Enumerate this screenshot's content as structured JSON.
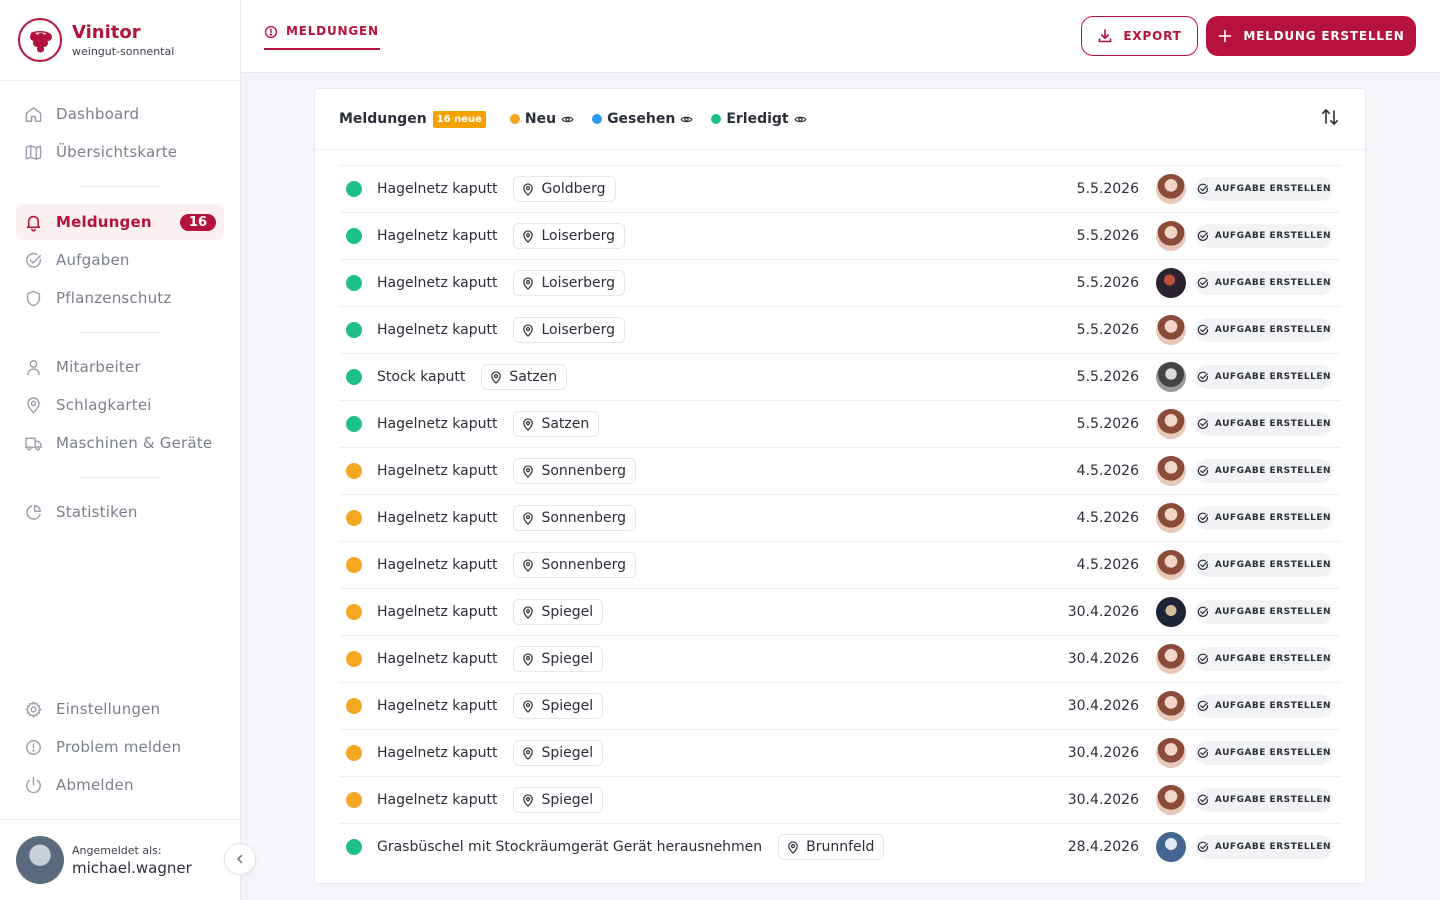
{
  "brand": {
    "name": "Vinitor",
    "subtitle": "weingut-sonnental"
  },
  "nav": {
    "dashboard": "Dashboard",
    "overview_map": "Übersichtskarte",
    "reports": "Meldungen",
    "reports_badge": "16",
    "tasks": "Aufgaben",
    "plant_protection": "Pflanzenschutz",
    "staff": "Mitarbeiter",
    "parcel_register": "Schlagkartei",
    "machines": "Maschinen & Geräte",
    "statistics": "Statistiken",
    "settings": "Einstellungen",
    "report_problem": "Problem melden",
    "logout": "Abmelden"
  },
  "user": {
    "caption": "Angemeldet als:",
    "name": "michael.wagner"
  },
  "header": {
    "tab_label": "MELDUNGEN",
    "export_label": "EXPORT",
    "new_label": "MELDUNG ERSTELLEN"
  },
  "card": {
    "title": "Meldungen",
    "new_badge": "16 neue",
    "legend_new": "Neu",
    "legend_seen": "Gesehen",
    "legend_done": "Erledigt"
  },
  "colors": {
    "accent": "#b5123e",
    "status_new": "#f5a623",
    "status_seen": "#2d9bf0",
    "status_done": "#1fc086"
  },
  "task_button_label": "AUFGABE ERSTELLEN",
  "reports": [
    {
      "status": "done",
      "title": "Hagelnetz kaputt",
      "location": "Goldberg",
      "date": "5.5.2026",
      "avatar": "woman"
    },
    {
      "status": "done",
      "title": "Hagelnetz kaputt",
      "location": "Loiserberg",
      "date": "5.5.2026",
      "avatar": "woman"
    },
    {
      "status": "done",
      "title": "Hagelnetz kaputt",
      "location": "Loiserberg",
      "date": "5.5.2026",
      "avatar": "dark"
    },
    {
      "status": "done",
      "title": "Hagelnetz kaputt",
      "location": "Loiserberg",
      "date": "5.5.2026",
      "avatar": "woman"
    },
    {
      "status": "done",
      "title": "Stock kaputt",
      "location": "Satzen",
      "date": "5.5.2026",
      "avatar": "gray"
    },
    {
      "status": "done",
      "title": "Hagelnetz kaputt",
      "location": "Satzen",
      "date": "5.5.2026",
      "avatar": "woman"
    },
    {
      "status": "new",
      "title": "Hagelnetz kaputt",
      "location": "Sonnenberg",
      "date": "4.5.2026",
      "avatar": "woman"
    },
    {
      "status": "new",
      "title": "Hagelnetz kaputt",
      "location": "Sonnenberg",
      "date": "4.5.2026",
      "avatar": "woman"
    },
    {
      "status": "new",
      "title": "Hagelnetz kaputt",
      "location": "Sonnenberg",
      "date": "4.5.2026",
      "avatar": "woman"
    },
    {
      "status": "new",
      "title": "Hagelnetz kaputt",
      "location": "Spiegel",
      "date": "30.4.2026",
      "avatar": "navy"
    },
    {
      "status": "new",
      "title": "Hagelnetz kaputt",
      "location": "Spiegel",
      "date": "30.4.2026",
      "avatar": "woman"
    },
    {
      "status": "new",
      "title": "Hagelnetz kaputt",
      "location": "Spiegel",
      "date": "30.4.2026",
      "avatar": "woman"
    },
    {
      "status": "new",
      "title": "Hagelnetz kaputt",
      "location": "Spiegel",
      "date": "30.4.2026",
      "avatar": "woman"
    },
    {
      "status": "new",
      "title": "Hagelnetz kaputt",
      "location": "Spiegel",
      "date": "30.4.2026",
      "avatar": "woman"
    },
    {
      "status": "done",
      "title": "Grasbüschel mit Stockräumgerät Gerät herausnehmen",
      "location": "Brunnfeld",
      "date": "28.4.2026",
      "avatar": "blue"
    }
  ]
}
